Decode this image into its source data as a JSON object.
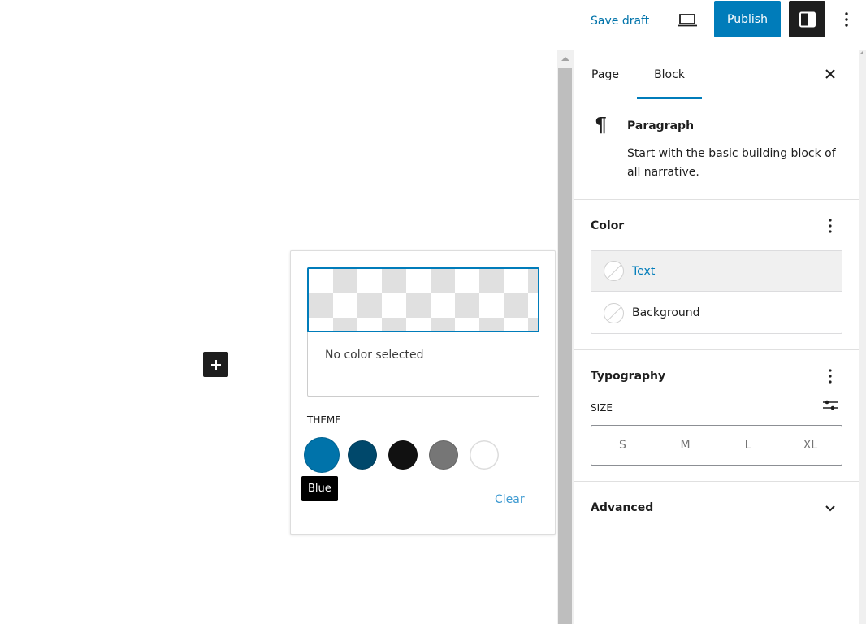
{
  "topbar": {
    "save_draft": "Save draft",
    "preview_icon": "laptop-icon",
    "publish": "Publish",
    "settings_icon": "sidebar-toggle-icon",
    "options_icon": "kebab-icon"
  },
  "canvas": {
    "inserter_icon": "plus-icon"
  },
  "sidebar": {
    "tabs": [
      {
        "label": "Page",
        "active": false
      },
      {
        "label": "Block",
        "active": true
      }
    ],
    "close_icon": "close-icon",
    "block": {
      "icon": "paragraph-icon",
      "title": "Paragraph",
      "description": "Start with the basic building block of all narrative."
    },
    "color_panel": {
      "title": "Color",
      "items": [
        {
          "label": "Text",
          "active": true
        },
        {
          "label": "Background",
          "active": false
        }
      ]
    },
    "typography_panel": {
      "title": "Typography",
      "size_label": "Size",
      "sizes": [
        "S",
        "M",
        "L",
        "XL"
      ]
    },
    "advanced_panel": {
      "title": "Advanced"
    }
  },
  "color_popover": {
    "status": "No color selected",
    "theme_label": "Theme",
    "swatches": [
      {
        "name": "Blue",
        "color": "#0073aa",
        "hovered": true
      },
      {
        "name": "Dark Blue",
        "color": "#00486b",
        "hovered": false
      },
      {
        "name": "Black",
        "color": "#111111",
        "hovered": false
      },
      {
        "name": "Gray",
        "color": "#767676",
        "hovered": false
      },
      {
        "name": "White",
        "color": "#ffffff",
        "hovered": false
      }
    ],
    "tooltip": "Blue",
    "clear": "Clear"
  },
  "colors": {
    "accent": "#007cba",
    "dark": "#1e1e1e"
  }
}
